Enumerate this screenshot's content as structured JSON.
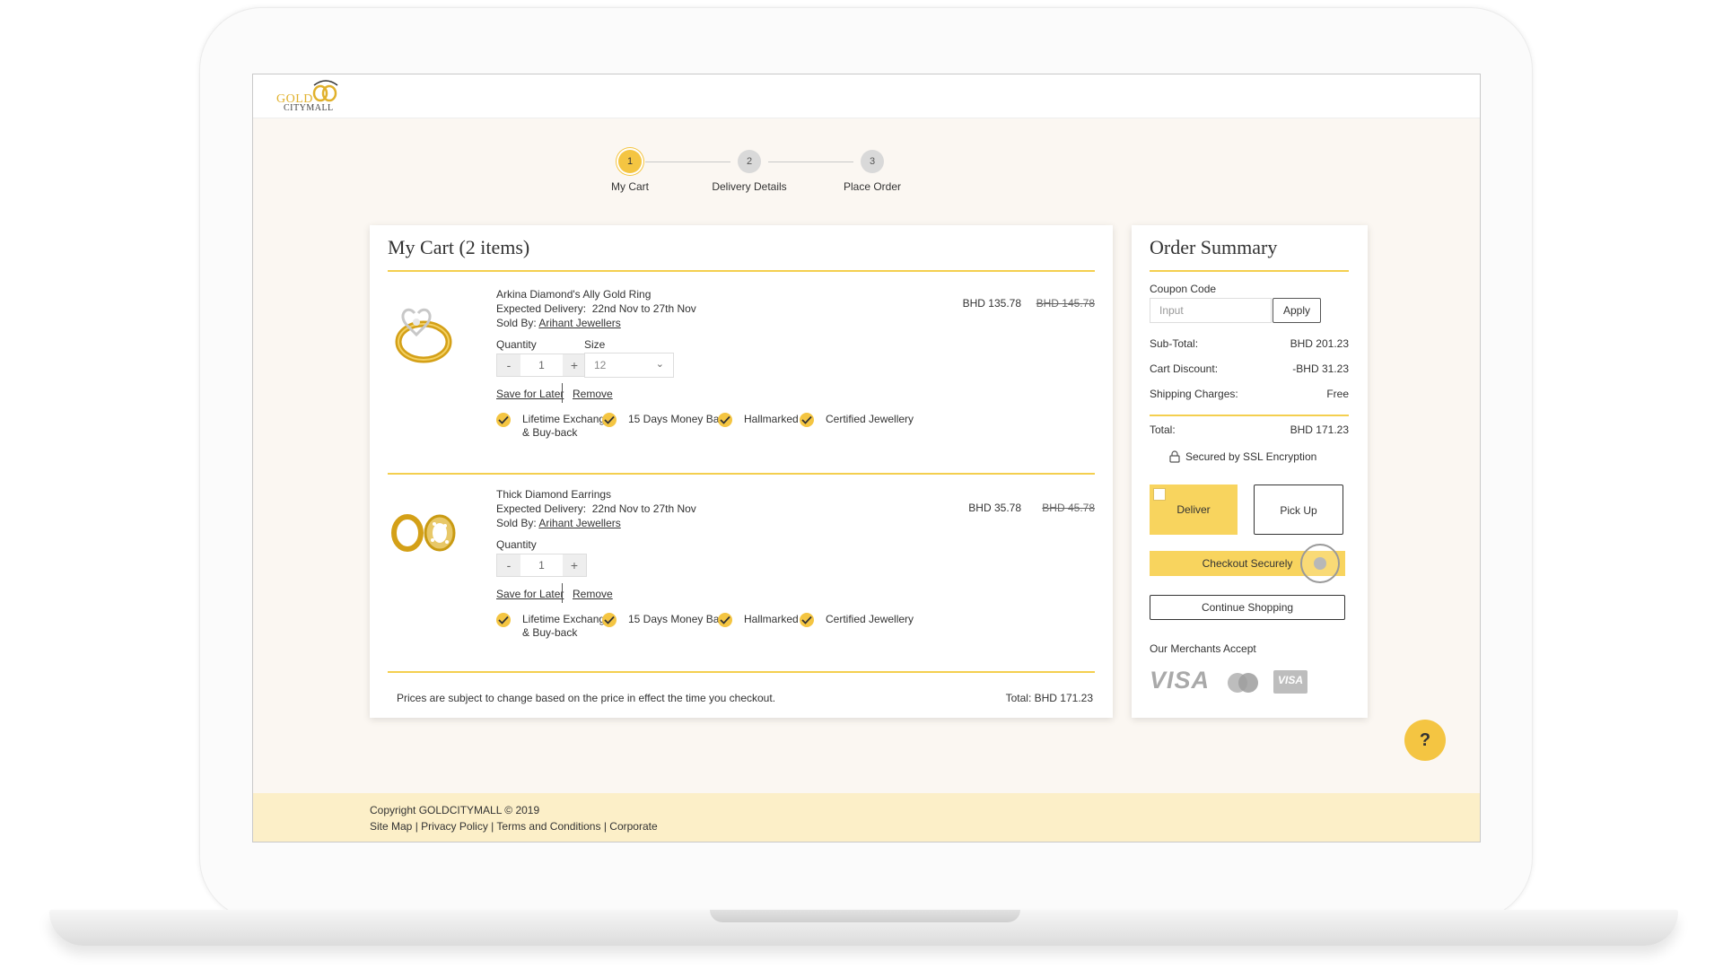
{
  "brand": {
    "logo_top": "GOLD",
    "logo_bottom": "CITYMALL"
  },
  "stepper": {
    "steps": [
      {
        "number": "1",
        "label": "My Cart"
      },
      {
        "number": "2",
        "label": "Delivery Details"
      },
      {
        "number": "3",
        "label": "Place Order"
      }
    ],
    "active_step": 1
  },
  "cart": {
    "title": "My Cart (2 items)",
    "items": [
      {
        "name": "Arkina Diamond's Ally Gold Ring",
        "delivery_label": "Expected Delivery:",
        "delivery": "22nd Nov to 27th Nov",
        "sold_by_label": "Sold By:",
        "seller": "Arihant Jewellers",
        "price": "BHD 135.78",
        "old_price": "BHD 145.78",
        "quantity_label": "Quantity",
        "quantity": "1",
        "size_label": "Size",
        "size": "12",
        "minus": "-",
        "plus": "+",
        "save_for_later": "Save for Later",
        "remove": "Remove"
      },
      {
        "name": "Thick Diamond Earrings",
        "delivery_label": "Expected Delivery:",
        "delivery": "22nd Nov to 27th Nov",
        "sold_by_label": "Sold By:",
        "seller": "Arihant Jewellers",
        "price": "BHD 35.78",
        "old_price": "BHD 45.78",
        "quantity_label": "Quantity",
        "quantity": "1",
        "minus": "-",
        "plus": "+",
        "save_for_later": "Save for Later",
        "remove": "Remove"
      }
    ],
    "badges": {
      "lifetime_line1": "Lifetime Exchange",
      "lifetime_line2": "& Buy-back",
      "money_back": "15 Days Money Back",
      "hallmarked": "Hallmarked",
      "certified": "Certified Jewellery"
    },
    "footer_note": "Prices are subject to change based on the price in effect the time you checkout.",
    "footer_total": "Total: BHD 171.23"
  },
  "summary": {
    "title": "Order Summary",
    "coupon_label": "Coupon Code",
    "coupon_placeholder": "Input",
    "apply": "Apply",
    "subtotal_label": "Sub-Total:",
    "subtotal": "BHD 201.23",
    "discount_label": "Cart Discount:",
    "discount": "-BHD 31.23",
    "shipping_label": "Shipping Charges:",
    "shipping": "Free",
    "total_label": "Total:",
    "total": "BHD 171.23",
    "ssl": "Secured by SSL Encryption",
    "deliver": "Deliver",
    "pickup": "Pick Up",
    "checkout": "Checkout Securely",
    "continue": "Continue Shopping",
    "merchants_label": "Our Merchants Accept",
    "pay_visa": "VISA",
    "pay_visa_card": "VISA"
  },
  "help": {
    "label": "?"
  },
  "footer": {
    "copyright": "Copyright GOLDCITYMALL © 2019",
    "links": [
      "Site Map",
      "Privacy Policy",
      "Terms and Conditions",
      "Corporate"
    ],
    "separator": " | "
  },
  "colors": {
    "accent": "#f4c542",
    "accent_light": "#f8d45e",
    "footer_bg": "#fcefc8",
    "page_bg": "#fbf7f2"
  }
}
